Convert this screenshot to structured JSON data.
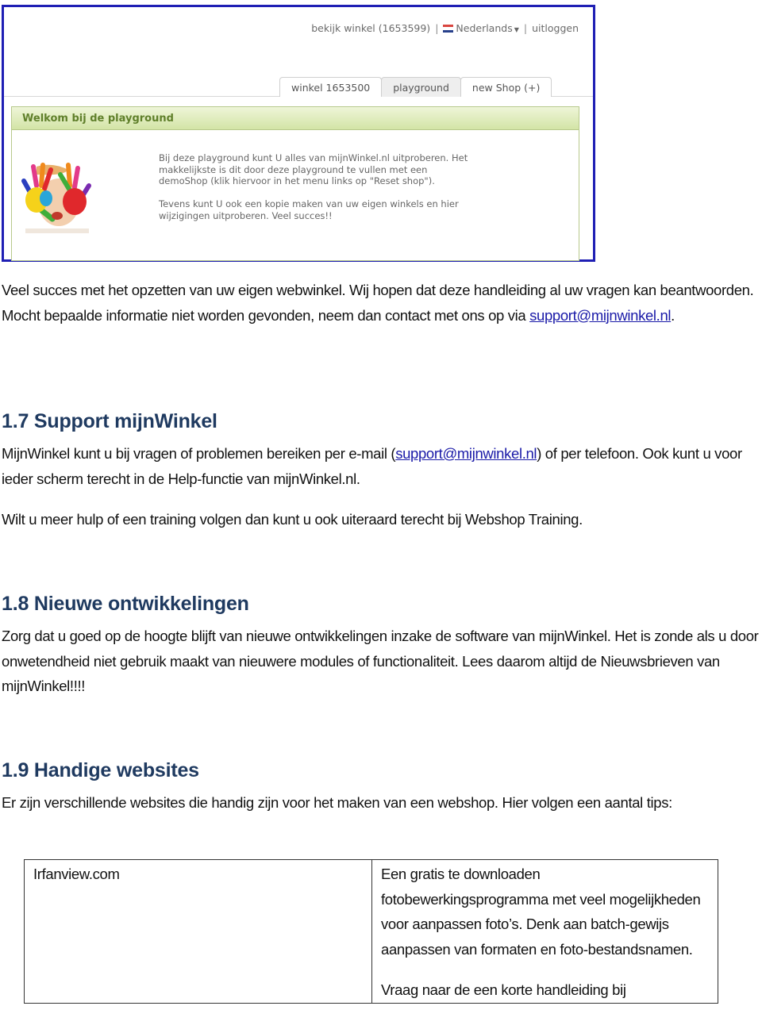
{
  "screenshot": {
    "top_links": {
      "view_shop": "bekijk winkel (1653599)",
      "separator": "|",
      "language": "Nederlands",
      "logout": "uitloggen"
    },
    "tabs": [
      {
        "label": "winkel 1653500",
        "active": false
      },
      {
        "label": "playground",
        "active": true
      },
      {
        "label": "new Shop (+)",
        "active": false
      }
    ],
    "panel": {
      "title": "Welkom bij de playground",
      "paragraphs": [
        "Bij deze playground kunt U alles van mijnWinkel.nl uitproberen. Het makkelijkste is dit door deze playground te vullen met een demoShop (klik hiervoor in het menu links op \"Reset shop\").",
        "Tevens kunt U ook een kopie maken van uw eigen winkels en hier wijzigingen uitproberen. Veel succes!!"
      ]
    },
    "colors": {
      "frame_border": "#1f1fb4",
      "panel_title": "#5f7f2a",
      "panel_border": "#b8c98c"
    }
  },
  "intro": {
    "text": "Veel succes met het opzetten van uw eigen webwinkel. Wij hopen dat deze handleiding al uw vragen kan beantwoorden. Mocht bepaalde informatie niet worden gevonden, neem dan contact met ons op via ",
    "link": "support@mijnwinkel.nl",
    "after": "."
  },
  "sections": [
    {
      "number": "1.7",
      "title": "Support mijnWinkel",
      "p1_before": "MijnWinkel kunt u bij vragen of problemen bereiken per e-mail  (",
      "p1_link": "support@mijnwinkel.nl",
      "p1_after": ") of per telefoon. Ook kunt u voor ieder scherm terecht in de Help-functie van mijnWinkel.nl.",
      "p2": "Wilt u meer hulp of een training volgen dan kunt u ook uiteraard terecht bij Webshop Training."
    },
    {
      "number": "1.8",
      "title": "Nieuwe ontwikkelingen",
      "p1": "Zorg dat u goed op de hoogte blijft van nieuwe ontwikkelingen inzake de software van mijnWinkel. Het is zonde als u door onwetendheid niet gebruik maakt van nieuwere modules of functionaliteit. Lees daarom altijd de Nieuwsbrieven van mijnWinkel!!!!"
    },
    {
      "number": "1.9",
      "title": "Handige websites",
      "p1": "Er zijn verschillende websites die handig zijn voor het maken van een webshop. Hier volgen een aantal tips:"
    }
  ],
  "table": {
    "rows": [
      {
        "site": "Irfanview.com",
        "description": "Een gratis te downloaden fotobewerkingsprogramma met veel mogelijkheden voor aanpassen foto’s. Denk aan batch-gewijs aanpassen van formaten en foto-bestandsnamen.",
        "note": "Vraag naar de een korte handleiding bij"
      }
    ]
  },
  "colors": {
    "heading": "#1f3a60",
    "link": "#1a1aa8"
  }
}
